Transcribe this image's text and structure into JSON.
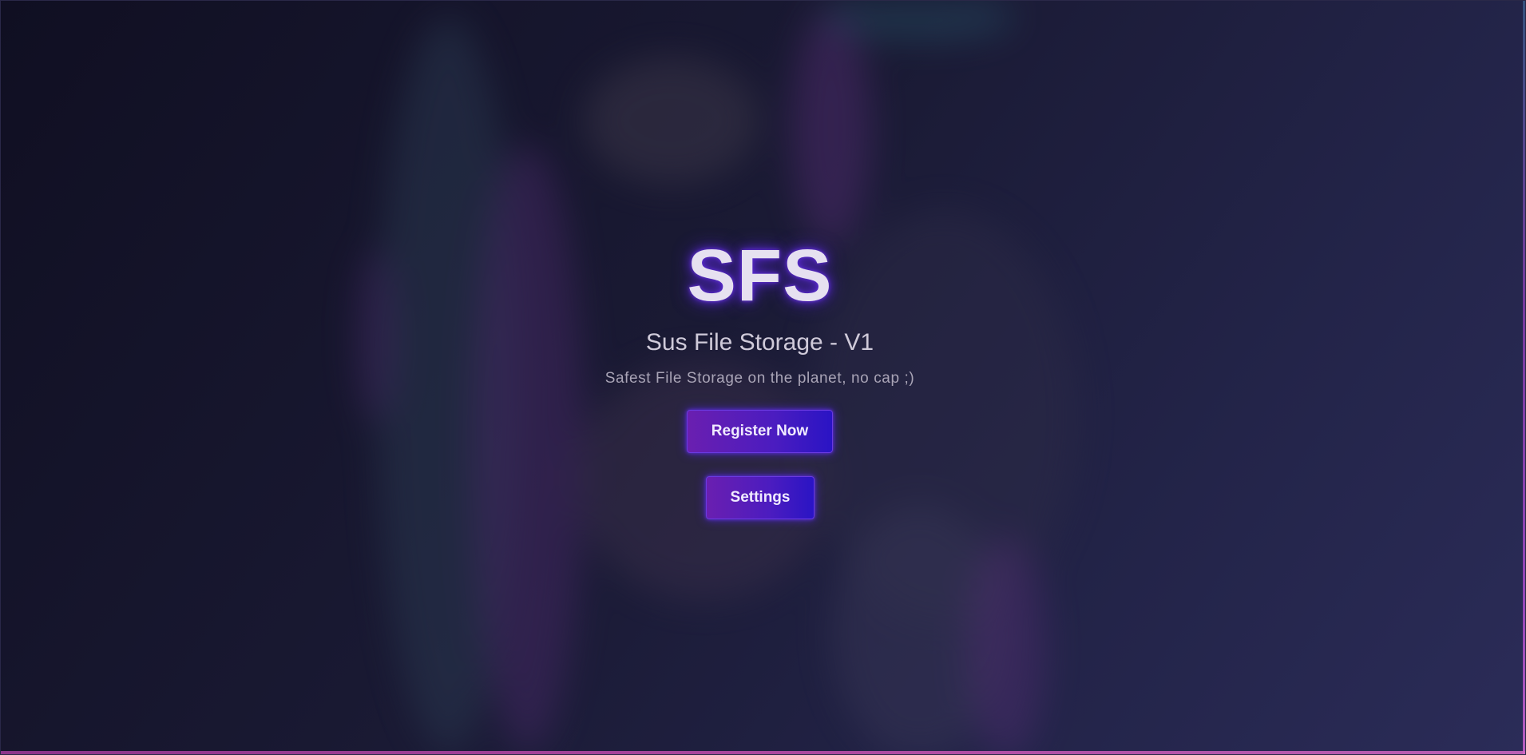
{
  "app": {
    "title": "SFS",
    "subtitle": "Sus File Storage - V1",
    "tagline": "Safest File Storage on the planet, no cap ;)"
  },
  "actions": {
    "register_label": "Register Now",
    "settings_label": "Settings"
  },
  "colors": {
    "accent": "#5b2bd6",
    "button_gradient_start": "#6a1fb0",
    "button_gradient_end": "#2a14c4",
    "background": "#1a1a34"
  }
}
